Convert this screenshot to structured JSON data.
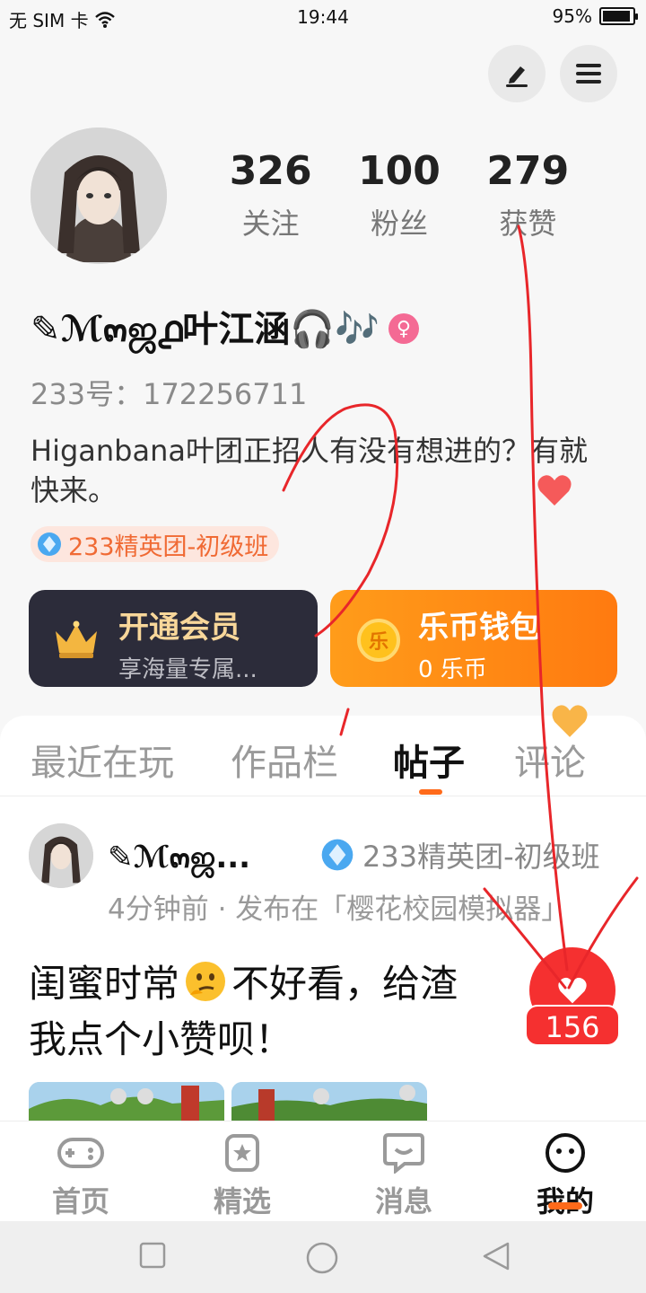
{
  "status_bar": {
    "carrier": "无 SIM 卡",
    "time": "19:44",
    "battery": "95%",
    "battery_level": 0.95
  },
  "header": {
    "edit_icon": "pen-icon",
    "menu_icon": "hamburger-menu-icon"
  },
  "profile": {
    "stats": [
      {
        "value": "326",
        "label": "关注"
      },
      {
        "value": "100",
        "label": "粉丝"
      },
      {
        "value": "279",
        "label": "获赞"
      }
    ],
    "nickname": "✎ℳ๓ஜ൧叶江涵🎧🎶",
    "gender_symbol": "♀",
    "uid": "233号：172256711",
    "bio": "Higanbana叶团正招人有没有想进的？有就快来。",
    "badge": "233精英团-初级班"
  },
  "cards": {
    "vip": {
      "title": "开通会员",
      "subtitle": "享海量专属..."
    },
    "wallet": {
      "coin_glyph": "乐",
      "title": "乐币钱包",
      "subtitle": "0 乐币"
    }
  },
  "tabs": [
    {
      "label": "最近在玩",
      "active": false
    },
    {
      "label": "作品栏",
      "active": false
    },
    {
      "label": "帖子",
      "active": true
    },
    {
      "label": "评论",
      "active": false
    }
  ],
  "post": {
    "author": "✎ℳ๓ஜ...",
    "badge": "233精英团-初级班",
    "meta": "4分钟前 · 发布在「樱花校园模拟器」",
    "title_part1": "闺蜜时常",
    "title_part2": "不好看，给渣",
    "title_line2": "我点个小赞呗！",
    "like_count": "156"
  },
  "bottom_nav": [
    {
      "label": "首页",
      "icon": "gamepad-icon",
      "active": false
    },
    {
      "label": "精选",
      "icon": "star-bookmark-icon",
      "active": false
    },
    {
      "label": "消息",
      "icon": "chat-bubble-icon",
      "active": false
    },
    {
      "label": "我的",
      "icon": "face-icon",
      "active": true
    }
  ],
  "colors": {
    "accent": "#ff6a1a",
    "like_red": "#f53030",
    "wallet_orange": "#ff8c14",
    "vip_dark": "#2c2c3a"
  }
}
